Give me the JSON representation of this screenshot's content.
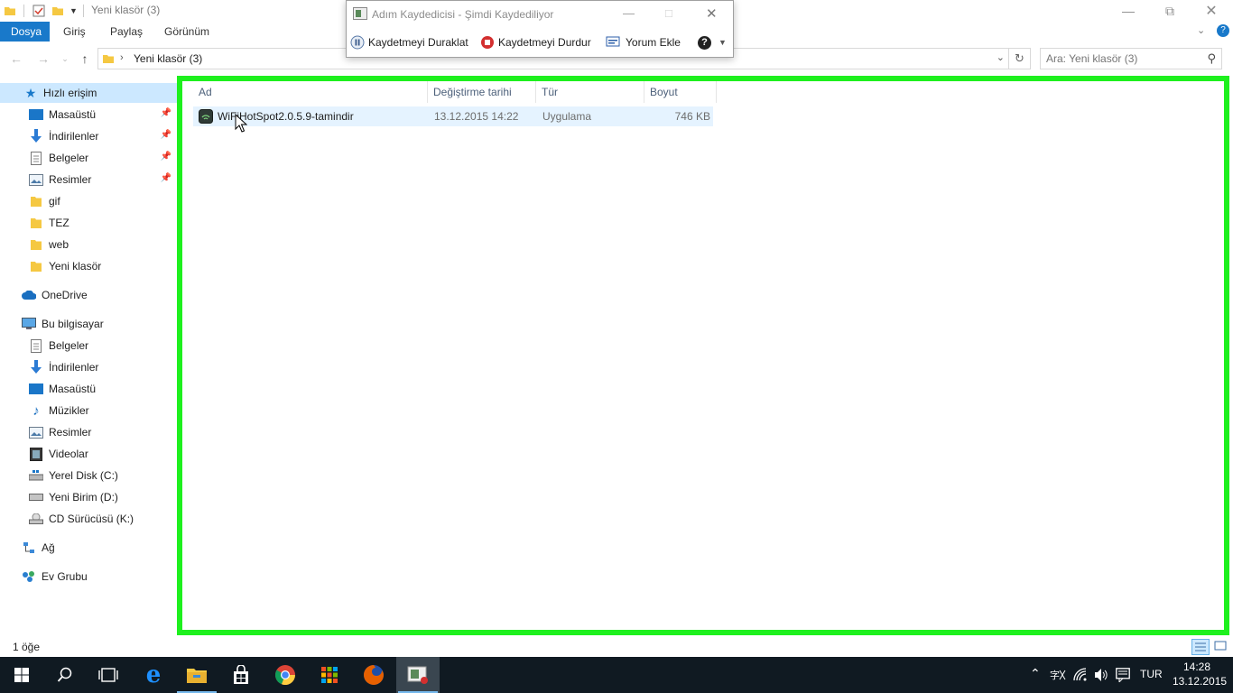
{
  "window": {
    "title": "Yeni klasör (3)"
  },
  "ribbon": {
    "tabs": [
      "Dosya",
      "Giriş",
      "Paylaş",
      "Görünüm"
    ]
  },
  "address": {
    "path": "Yeni klasör (3)"
  },
  "search": {
    "placeholder": "Ara: Yeni klasör (3)"
  },
  "nav": {
    "quick_access": "Hızlı erişim",
    "quick_items": [
      {
        "label": "Masaüstü",
        "icon": "desktop-icon",
        "pinned": true
      },
      {
        "label": "İndirilenler",
        "icon": "downloads-icon",
        "pinned": true
      },
      {
        "label": "Belgeler",
        "icon": "documents-icon",
        "pinned": true
      },
      {
        "label": "Resimler",
        "icon": "pictures-icon",
        "pinned": true
      },
      {
        "label": "gif",
        "icon": "folder-icon",
        "pinned": false
      },
      {
        "label": "TEZ",
        "icon": "folder-icon",
        "pinned": false
      },
      {
        "label": "web",
        "icon": "folder-icon",
        "pinned": false
      },
      {
        "label": "Yeni klasör",
        "icon": "folder-icon",
        "pinned": false
      }
    ],
    "onedrive": "OneDrive",
    "this_pc": "Bu bilgisayar",
    "pc_items": [
      {
        "label": "Belgeler",
        "icon": "documents-icon"
      },
      {
        "label": "İndirilenler",
        "icon": "downloads-icon"
      },
      {
        "label": "Masaüstü",
        "icon": "desktop-icon"
      },
      {
        "label": "Müzikler",
        "icon": "music-icon"
      },
      {
        "label": "Resimler",
        "icon": "pictures-icon"
      },
      {
        "label": "Videolar",
        "icon": "videos-icon"
      },
      {
        "label": "Yerel Disk (C:)",
        "icon": "local-disk-icon"
      },
      {
        "label": "Yeni Birim (D:)",
        "icon": "drive-icon"
      },
      {
        "label": "CD Sürücüsü (K:)",
        "icon": "cd-drive-icon"
      }
    ],
    "network": "Ağ",
    "homegroup": "Ev Grubu"
  },
  "columns": {
    "name": "Ad",
    "modified": "Değiştirme tarihi",
    "type": "Tür",
    "size": "Boyut"
  },
  "files": [
    {
      "name": "WiFiHotSpot2.0.5.9-tamindir",
      "modified": "13.12.2015 14:22",
      "type": "Uygulama",
      "size": "746 KB"
    }
  ],
  "status": {
    "count": "1 öğe"
  },
  "recorder": {
    "title": "Adım Kaydedicisi - Şimdi Kaydediliyor",
    "pause": "Kaydetmeyi Duraklat",
    "stop": "Kaydetmeyi Durdur",
    "comment": "Yorum Ekle",
    "help": "?"
  },
  "taskbar": {
    "language": "TUR",
    "time": "14:28",
    "date": "13.12.2015"
  },
  "colors": {
    "accent": "#1979ca",
    "highlight": "#1ef01e",
    "selection": "#cce8ff",
    "taskbar": "#101a22"
  }
}
